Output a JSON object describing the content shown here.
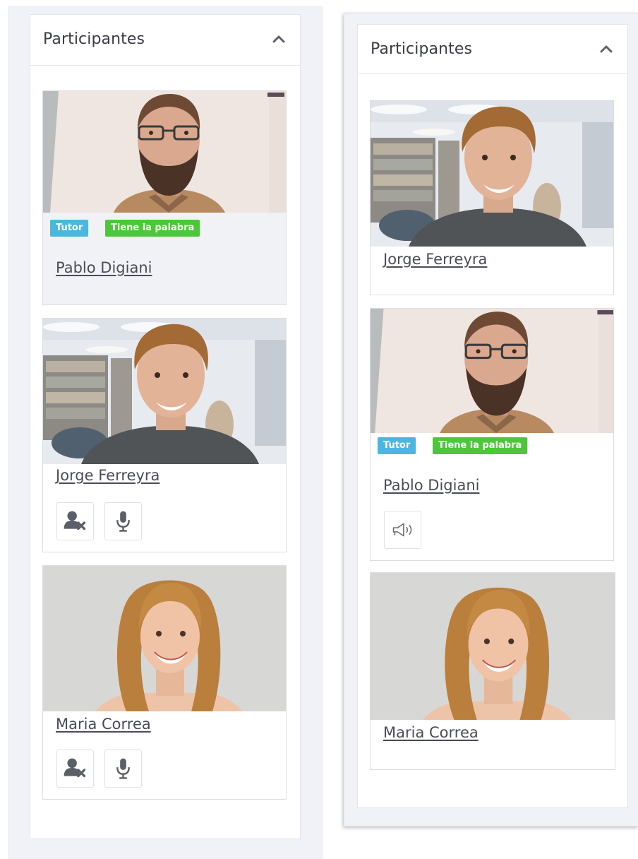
{
  "left_panel": {
    "title": "Participantes",
    "collapse_icon": "chevron-up-icon",
    "participants": [
      {
        "name": "Pablo Digiani",
        "badges": [
          "Tutor",
          "Tiene la palabra"
        ]
      },
      {
        "name": "Jorge Ferreyra",
        "controls": [
          "remove-user-icon",
          "microphone-icon"
        ]
      },
      {
        "name": "Maria Correa",
        "controls": [
          "remove-user-icon",
          "microphone-icon"
        ]
      }
    ]
  },
  "right_panel": {
    "title": "Participantes",
    "collapse_icon": "chevron-up-icon",
    "participants": [
      {
        "name": "Jorge Ferreyra"
      },
      {
        "name": "Pablo Digiani",
        "badges": [
          "Tutor",
          "Tiene la palabra"
        ],
        "controls": [
          "megaphone-icon"
        ]
      },
      {
        "name": "Maria Correa"
      }
    ]
  },
  "colors": {
    "tutor_badge": "#4ab7de",
    "floor_badge": "#4cc73a",
    "background": "#f1f2f7"
  }
}
